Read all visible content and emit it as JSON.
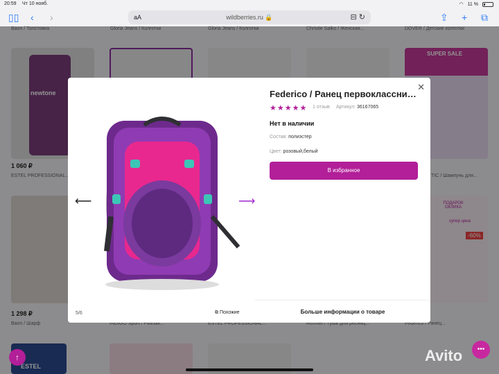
{
  "status": {
    "time": "20:59",
    "date": "Чт 10 нояб.",
    "battery": "11 %"
  },
  "browser": {
    "aa": "аА",
    "domain": "wildberries.ru",
    "lock": "🔒"
  },
  "background": {
    "top_labels": [
      "Baon / Толстовка",
      "Gloria Jeans / Колготки",
      "Gloria Jeans / Колготки",
      "Christie Saiko / Женская...",
      "DOVER / Детские колготки"
    ],
    "mid_prices": [
      "1 060 ₽",
      "ESTEL PROFESSIONAL..."
    ],
    "mid_right_label": "TIC / Шампунь для...",
    "bottom_price": "1 298 ₽",
    "bottom_labels": [
      "Baon / Шарф",
      "INDIGO Sport / Рюкзак...",
      "ESTEL PROFESSIONAL...",
      "Rimmel / Тушь для ресниц...",
      "Federico / Ранец..."
    ],
    "promo_super_sale": "SUPER SALE",
    "promo_gift": "ПОДАРОК ОКЛИКА",
    "promo_supercena": "супер цена",
    "promo_discount": "-60%",
    "card_brand_1": "newtone",
    "card_brand_2": "ESTEL"
  },
  "product": {
    "title": "Federico / Ранец первоклассника...",
    "stars": "★★★★★",
    "reviews": "1 отзыв",
    "article_label": "Артикул:",
    "article_value": "36167065",
    "stock": "Нет в наличии",
    "material_label": "Состав:",
    "material_value": "полиэстер",
    "color_label": "Цвет:",
    "color_value": "розовый,белый",
    "favorite_button": "В избранное",
    "more_info": "Больше информации о товаре"
  },
  "gallery": {
    "counter": "5/6",
    "similar": "Похожие"
  },
  "colors": {
    "accent": "#b21f99",
    "purple_arrow": "#a22ad0"
  },
  "watermark": "Avito"
}
